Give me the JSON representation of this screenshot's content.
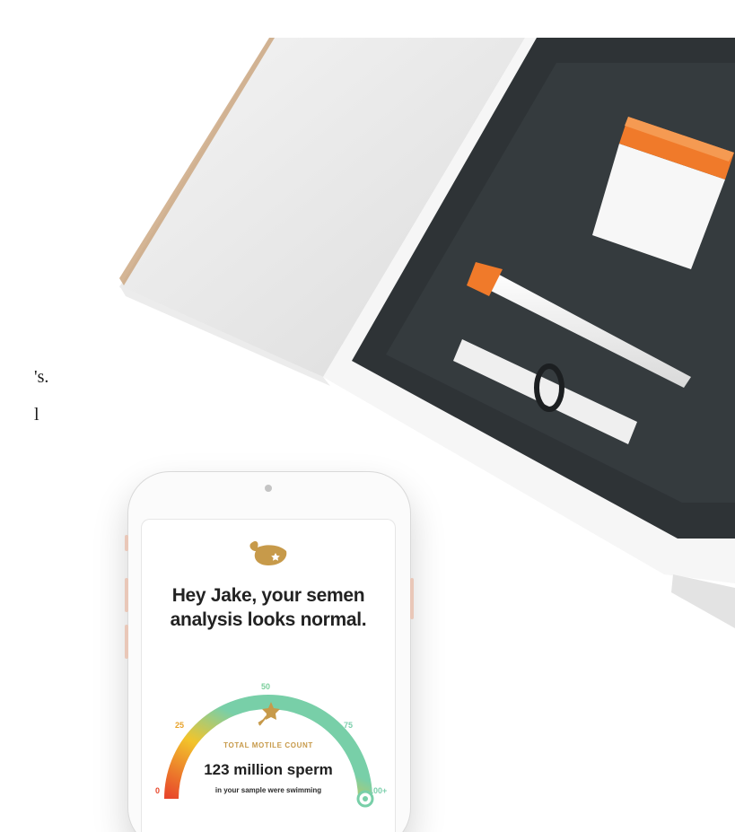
{
  "page_text": {
    "cutoff_line_1": "'s.",
    "cutoff_line_2": "l"
  },
  "phone_screen": {
    "headline": "Hey Jake, your semen analysis looks normal.",
    "gauge": {
      "ticks": [
        "0",
        "25",
        "50",
        "75",
        "100+"
      ],
      "value_percent": 100,
      "colors": {
        "low": "#e8472b",
        "mid": "#f2c42b",
        "high": "#78cfa8"
      }
    },
    "metric_label": "TOTAL MOTILE COUNT",
    "metric_value": "123 million sperm",
    "metric_subtext": "in your sample were swimming"
  },
  "icons": {
    "brand": "whale-logo-icon",
    "metric": "shooting-star-icon"
  },
  "colors": {
    "brand_gold": "#c79a4a",
    "tray_dark": "#2e3336",
    "cap_orange": "#f07a2a"
  }
}
